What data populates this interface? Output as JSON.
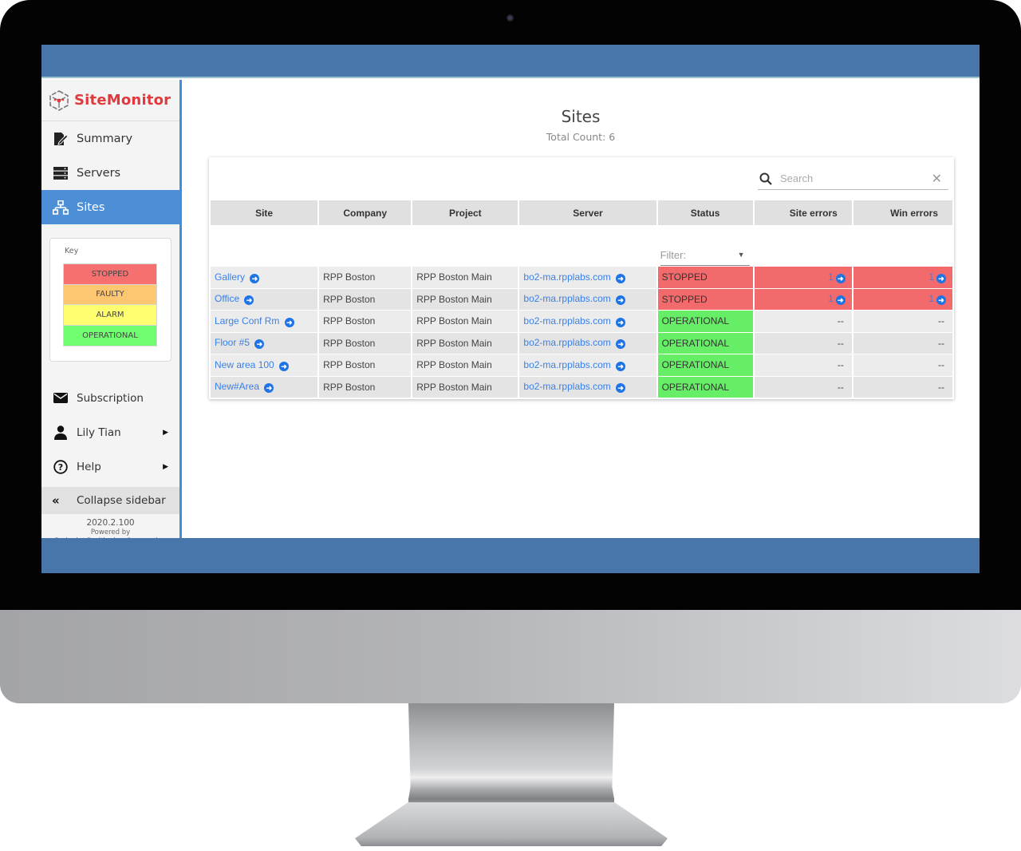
{
  "app": {
    "brand": "SiteMonitor",
    "accent_color": "#4c8fd6",
    "brand_color": "#e03a3e"
  },
  "sidebar": {
    "nav": [
      {
        "label": "Summary",
        "icon": "edit-document-icon",
        "active": false
      },
      {
        "label": "Servers",
        "icon": "server-icon",
        "active": false
      },
      {
        "label": "Sites",
        "icon": "sitemap-icon",
        "active": true
      }
    ],
    "key": {
      "label": "Key",
      "items": [
        {
          "label": "STOPPED",
          "color": "#f77070"
        },
        {
          "label": "FAULTY",
          "color": "#fdc670"
        },
        {
          "label": "ALARM",
          "color": "#fefe70"
        },
        {
          "label": "OPERATIONAL",
          "color": "#70fe70"
        }
      ]
    },
    "bottom_nav": [
      {
        "label": "Subscription",
        "icon": "envelope-icon"
      },
      {
        "label": "Lily Tian",
        "icon": "user-icon",
        "has_submenu": true
      },
      {
        "label": "Help",
        "icon": "question-circle-icon",
        "has_submenu": true
      }
    ],
    "collapse_label": "Collapse sidebar",
    "version": "2020.2.100",
    "powered_by": "Powered by",
    "company": "Redpoint Positioning Corporation"
  },
  "main": {
    "title": "Sites",
    "subtitle": "Total Count: 6",
    "search": {
      "placeholder": "Search",
      "value": ""
    },
    "status_filter": {
      "placeholder": "Filter:"
    },
    "columns": [
      "Site",
      "Company",
      "Project",
      "Server",
      "Status",
      "Site errors",
      "Win errors"
    ],
    "rows": [
      {
        "site": "Gallery",
        "company": "RPP Boston",
        "project": "RPP Boston Main",
        "server": "bo2-ma.rpplabs.com",
        "status": "STOPPED",
        "site_errors": "1",
        "win_errors": "1"
      },
      {
        "site": "Office",
        "company": "RPP Boston",
        "project": "RPP Boston Main",
        "server": "bo2-ma.rpplabs.com",
        "status": "STOPPED",
        "site_errors": "1",
        "win_errors": "1"
      },
      {
        "site": "Large Conf Rm",
        "company": "RPP Boston",
        "project": "RPP Boston Main",
        "server": "bo2-ma.rpplabs.com",
        "status": "OPERATIONAL",
        "site_errors": "--",
        "win_errors": "--"
      },
      {
        "site": "Floor #5",
        "company": "RPP Boston",
        "project": "RPP Boston Main",
        "server": "bo2-ma.rpplabs.com",
        "status": "OPERATIONAL",
        "site_errors": "--",
        "win_errors": "--"
      },
      {
        "site": "New area 100",
        "company": "RPP Boston",
        "project": "RPP Boston Main",
        "server": "bo2-ma.rpplabs.com",
        "status": "OPERATIONAL",
        "site_errors": "--",
        "win_errors": "--"
      },
      {
        "site": "New#Area",
        "company": "RPP Boston",
        "project": "RPP Boston Main",
        "server": "bo2-ma.rpplabs.com",
        "status": "OPERATIONAL",
        "site_errors": "--",
        "win_errors": "--"
      }
    ]
  }
}
